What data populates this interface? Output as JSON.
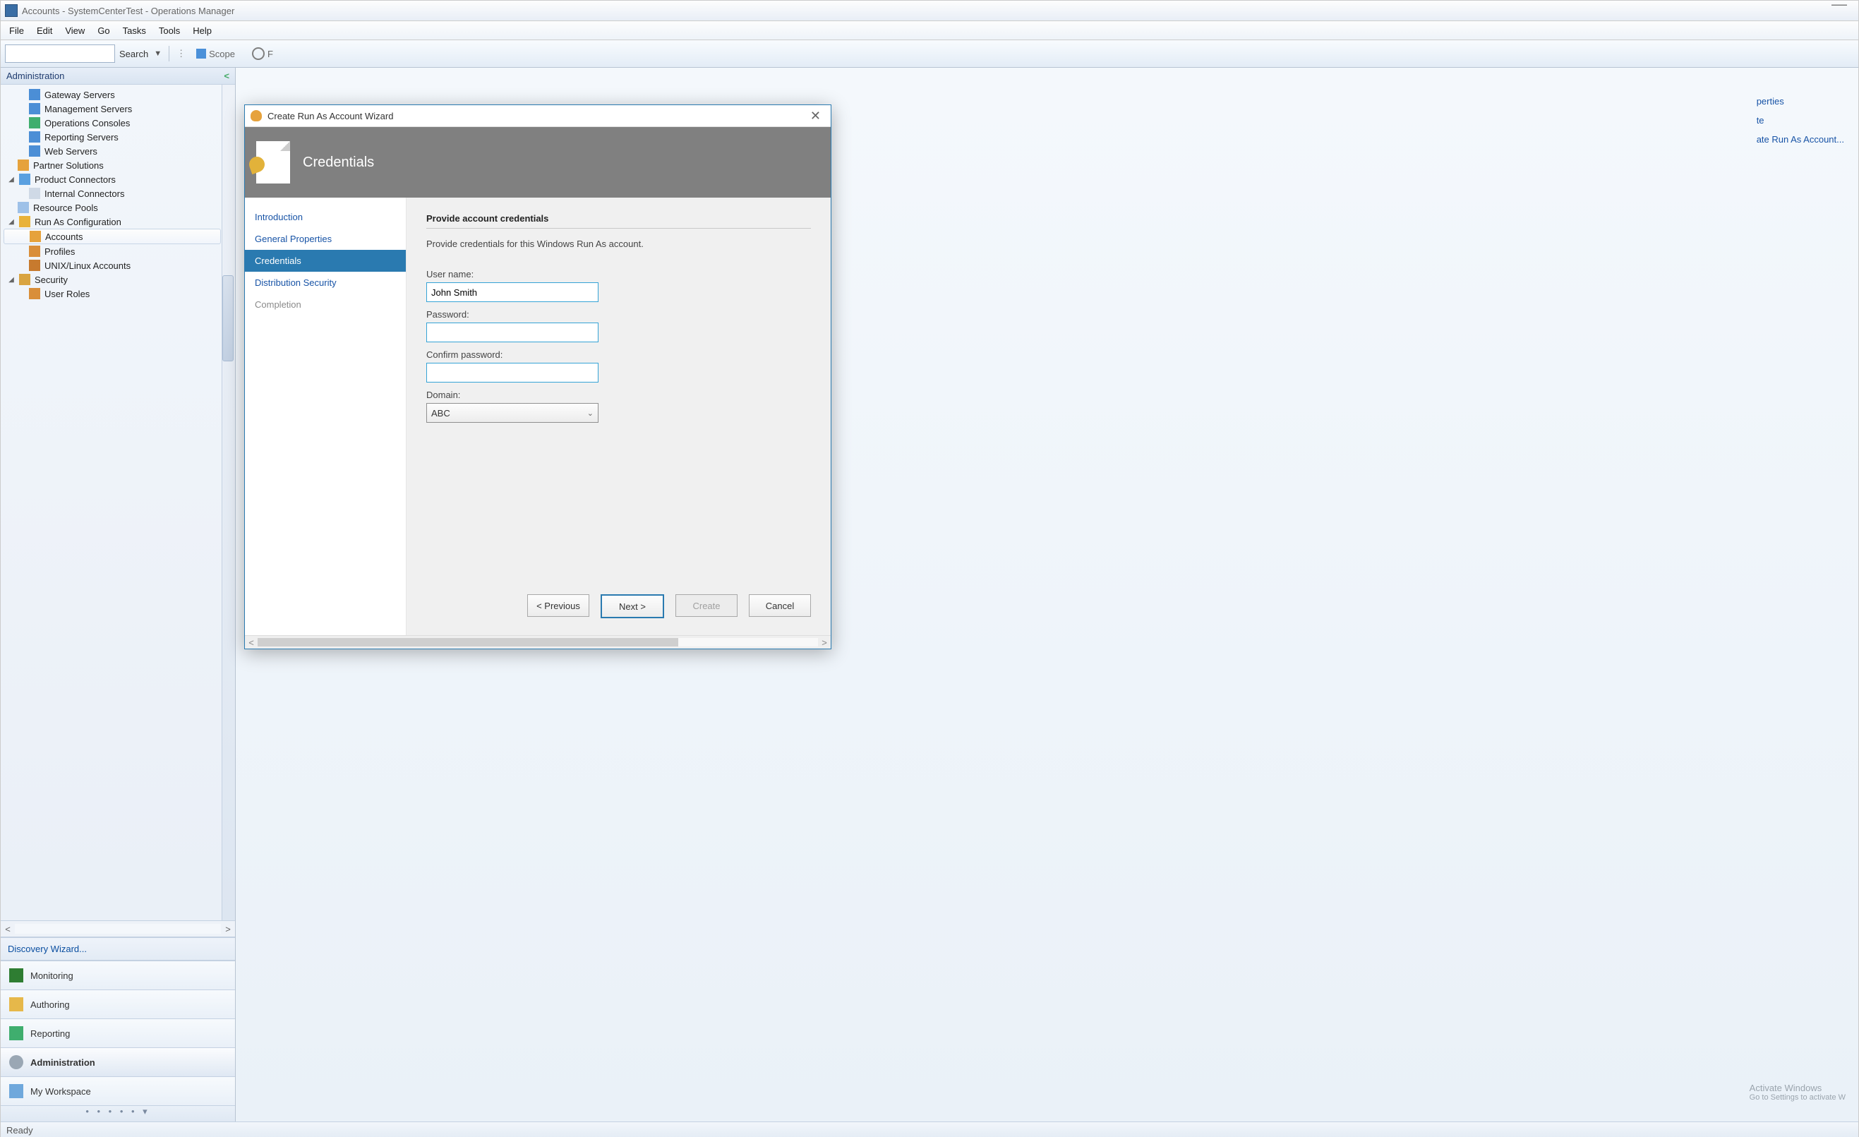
{
  "window": {
    "title": "Accounts - SystemCenterTest - Operations Manager"
  },
  "menu": {
    "file": "File",
    "edit": "Edit",
    "view": "View",
    "go": "Go",
    "tasks": "Tasks",
    "tools": "Tools",
    "help": "Help"
  },
  "toolbar": {
    "search_label": "Search",
    "scope_label": "Scope",
    "find_prefix": "F"
  },
  "nav": {
    "header": "Administration",
    "discovery_link": "Discovery Wizard...",
    "tree": {
      "gateway": "Gateway Servers",
      "mgmt": "Management Servers",
      "opconsoles": "Operations Consoles",
      "reporting": "Reporting Servers",
      "web": "Web Servers",
      "partner": "Partner Solutions",
      "prodconn": "Product Connectors",
      "internal": "Internal Connectors",
      "respools": "Resource Pools",
      "runas": "Run As Configuration",
      "accounts": "Accounts",
      "profiles": "Profiles",
      "unix": "UNIX/Linux Accounts",
      "security": "Security",
      "userroles": "User Roles"
    },
    "wunderbar": {
      "monitoring": "Monitoring",
      "authoring": "Authoring",
      "reporting": "Reporting",
      "administration": "Administration",
      "myworkspace": "My Workspace"
    }
  },
  "actions": {
    "properties": "perties",
    "delete": "te",
    "create": "ate Run As Account..."
  },
  "dialog": {
    "title": "Create Run As Account Wizard",
    "header": "Credentials",
    "steps": {
      "intro": "Introduction",
      "general": "General Properties",
      "creds": "Credentials",
      "dist": "Distribution Security",
      "completion": "Completion"
    },
    "section_title": "Provide account credentials",
    "help_text": "Provide credentials for this Windows Run As account.",
    "username_label": "User name:",
    "username_value": "John Smith",
    "password_label": "Password:",
    "password_value": "",
    "confirm_label": "Confirm password:",
    "confirm_value": "",
    "domain_label": "Domain:",
    "domain_value": "ABC",
    "buttons": {
      "previous": "< Previous",
      "next": "Next >",
      "create": "Create",
      "cancel": "Cancel"
    }
  },
  "status": {
    "text": "Ready"
  },
  "activate": {
    "line1": "Activate Windows",
    "line2": "Go to Settings to activate W"
  }
}
